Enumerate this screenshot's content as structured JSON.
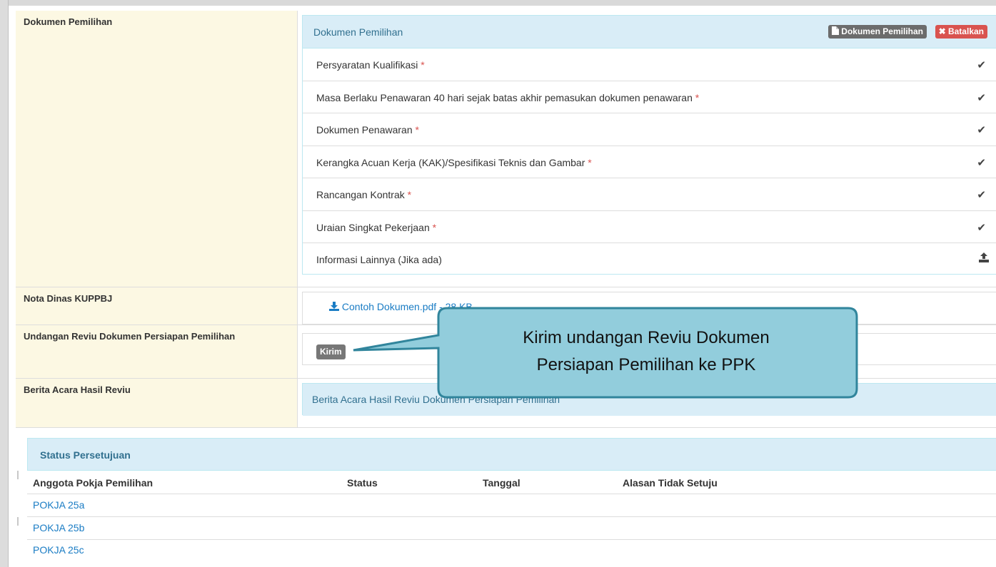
{
  "rows": {
    "dokumen_pemilihan": {
      "label": "Dokumen Pemilihan",
      "panel_title": "Dokumen Pemilihan",
      "btn_dokumen": "Dokumen Pemilihan",
      "btn_batalkan": "Batalkan",
      "items": [
        {
          "text": "Persyaratan Kualifikasi",
          "required": "*",
          "icon": "check-icon"
        },
        {
          "text": "Masa Berlaku Penawaran 40 hari sejak batas akhir pemasukan dokumen penawaran",
          "required": "*",
          "icon": "check-icon"
        },
        {
          "text": "Dokumen Penawaran",
          "required": "*",
          "icon": "check-icon"
        },
        {
          "text": "Kerangka Acuan Kerja (KAK)/Spesifikasi Teknis dan Gambar",
          "required": "*",
          "icon": "check-icon"
        },
        {
          "text": "Rancangan Kontrak",
          "required": "*",
          "icon": "check-icon"
        },
        {
          "text": "Uraian Singkat Pekerjaan",
          "required": "*",
          "icon": "check-icon"
        },
        {
          "text": "Informasi Lainnya (Jika ada)",
          "required": "",
          "icon": "upload-icon"
        }
      ]
    },
    "nota_dinas": {
      "label": "Nota Dinas KUPPBJ",
      "file_link": "Contoh Dokumen.pdf - 28 KB"
    },
    "undangan": {
      "label": "Undangan Reviu Dokumen Persiapan Pemilihan",
      "button": "Kirim"
    },
    "berita_acara": {
      "label": "Berita Acara Hasil Reviu",
      "panel_title": "Berita Acara Hasil Reviu Dokumen Persiapan Pemilihan"
    }
  },
  "status": {
    "title": "Status Persetujuan",
    "columns": [
      "Anggota Pokja Pemilihan",
      "Status",
      "Tanggal",
      "Alasan Tidak Setuju"
    ],
    "members": [
      "POKJA 25a",
      "POKJA 25b",
      "POKJA 25c"
    ]
  },
  "callout": {
    "line1": "Kirim undangan Reviu Dokumen",
    "line2": "Persiapan Pemilihan ke PPK",
    "fill": "#92cddc",
    "stroke": "#31859c"
  },
  "colors": {
    "label_bg": "#fcf8e3",
    "panel_head": "#d9edf7",
    "link": "#1a7cc4",
    "danger": "#d9534f"
  }
}
